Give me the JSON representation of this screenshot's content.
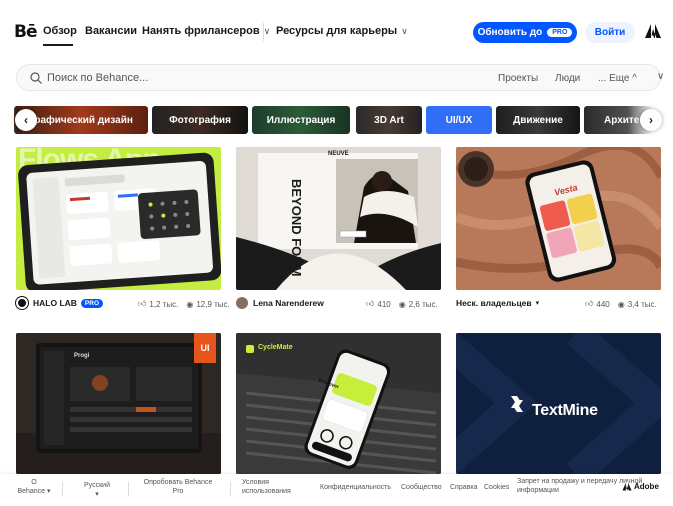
{
  "nav": {
    "logo": "Bē",
    "items": [
      "Обзор",
      "Вакансии",
      "Нанять фрилансеров",
      "Ресурсы для карьеры"
    ],
    "upgrade_label": "Обновить до",
    "upgrade_badge": "PRO",
    "login_label": "Войти",
    "adobe_icon": "adobe-logo"
  },
  "search": {
    "placeholder": "Поиск по Behance...",
    "tabs": [
      "Проекты",
      "Люди"
    ],
    "more_label": "... Еще ^"
  },
  "categories": [
    "Графический дизайн",
    "Фотография",
    "Иллюстрация",
    "3D Art",
    "UI/UX",
    "Движение",
    "Архитектура"
  ],
  "accent_color": "#0057ff",
  "projects": [
    {
      "owner": "HALO LAB",
      "owner_badge": "PRO",
      "likes": "1,2 тыс.",
      "views": "12,9 тыс.",
      "cover_text": "Flows App"
    },
    {
      "owner": "Lena Narenderew",
      "likes": "410",
      "views": "2,6 тыс.",
      "cover_brand": "NEUVE",
      "cover_text": "BEYOND FORM"
    },
    {
      "owner": "Неск. владельцев",
      "likes": "440",
      "views": "3,4 тыс.",
      "cover_text": "Vesta"
    },
    {
      "owner": "",
      "cover_badge": "UI",
      "cover_text": "Progi"
    },
    {
      "owner": "",
      "cover_brand": "CycleMate",
      "cover_text": "Discover"
    },
    {
      "owner": "",
      "cover_text": "TextMine"
    }
  ],
  "footer": {
    "about": "О Behance",
    "language": "Русский",
    "try_pro": "Опробовать Behance Pro",
    "terms": "Условия использования",
    "privacy": "Конфиденциальность",
    "community": "Сообщество",
    "help": "Справка",
    "cookies": "Cookies",
    "do_not_sell": "Запрет на продажу и передачу личной информации",
    "adobe": "Adobe"
  }
}
